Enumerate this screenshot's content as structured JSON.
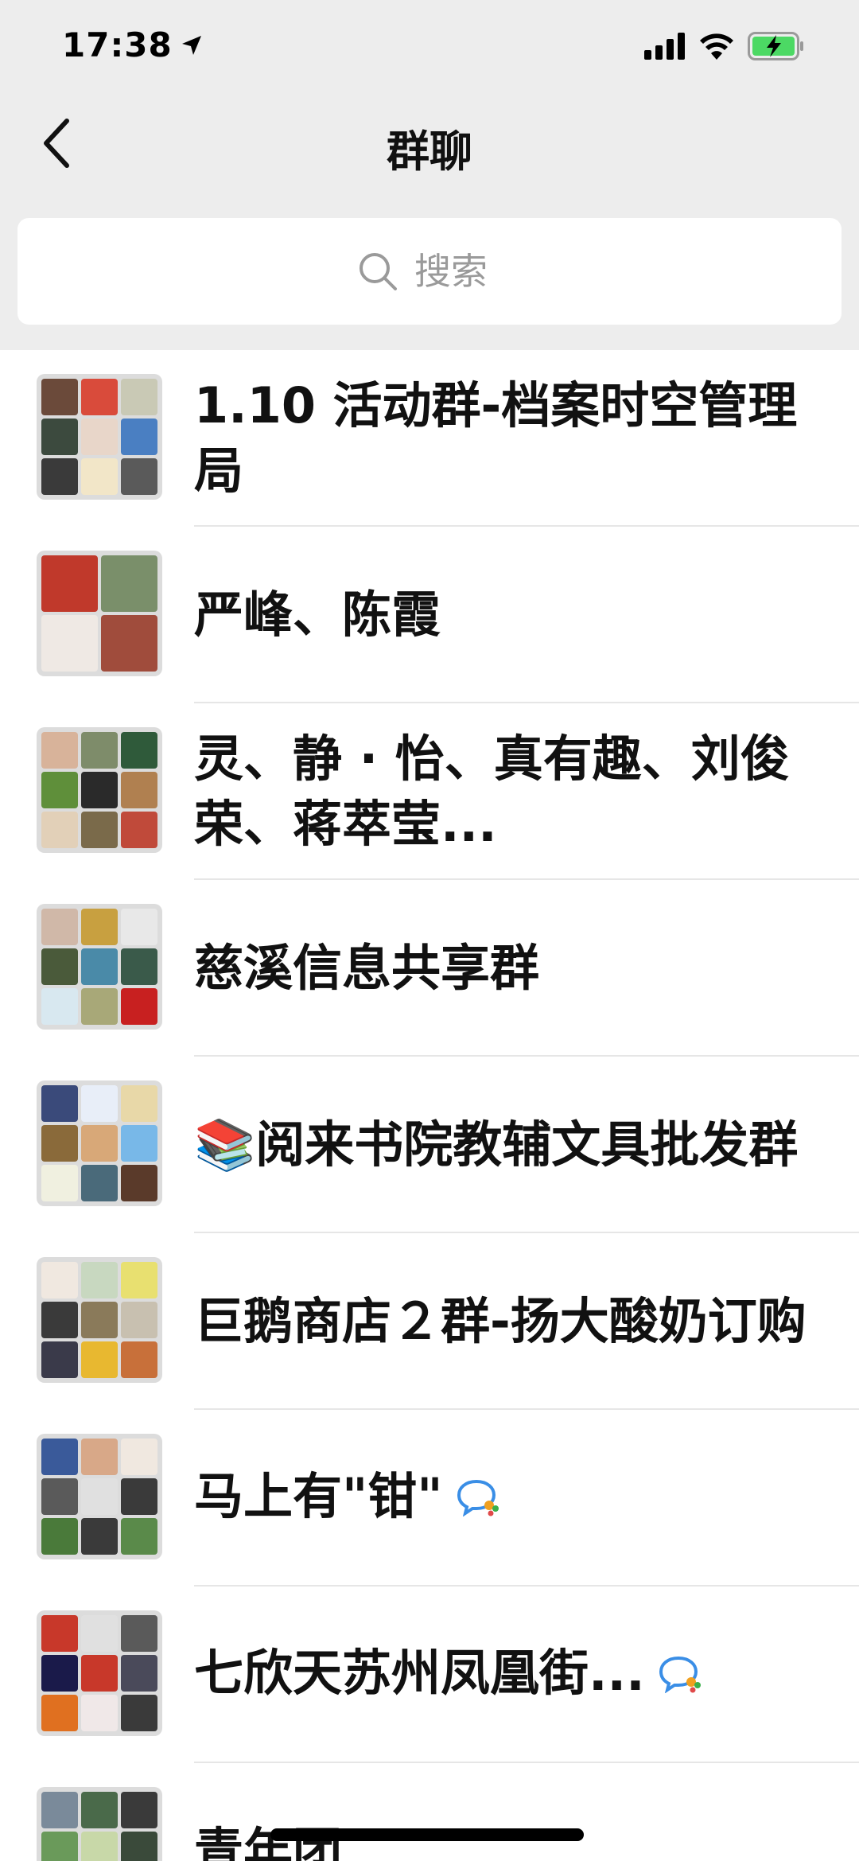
{
  "status_bar": {
    "time": "17:38",
    "icons": [
      "location-arrow-icon",
      "cellular-signal-icon",
      "wifi-icon",
      "battery-charging-icon"
    ],
    "battery_color": "#4cd964"
  },
  "nav": {
    "title": "群聊",
    "back_icon": "chevron-left-icon"
  },
  "search": {
    "placeholder": "搜索",
    "icon": "search-icon"
  },
  "groups": [
    {
      "name": "1.10 活动群-档案时空管理局",
      "badge": false
    },
    {
      "name": "严峰、陈霞",
      "badge": false
    },
    {
      "name": "灵、静 · 怡、真有趣、刘俊荣、蒋萃莹...",
      "badge": false
    },
    {
      "name": "慈溪信息共享群",
      "badge": false
    },
    {
      "name": "📚阅来书院教辅文具批发群",
      "badge": false
    },
    {
      "name": "巨鹅商店２群-扬大酸奶订购",
      "badge": false
    },
    {
      "name": "马上有\"钳\"",
      "badge": true
    },
    {
      "name": "七欣天苏州凤凰街...",
      "badge": true
    },
    {
      "name": "青年团",
      "badge": false
    }
  ],
  "colors": {
    "header_bg": "#ededed",
    "list_bg": "#ffffff",
    "divider": "#e6e6e6",
    "badge_blue": "#3a8ee6"
  }
}
